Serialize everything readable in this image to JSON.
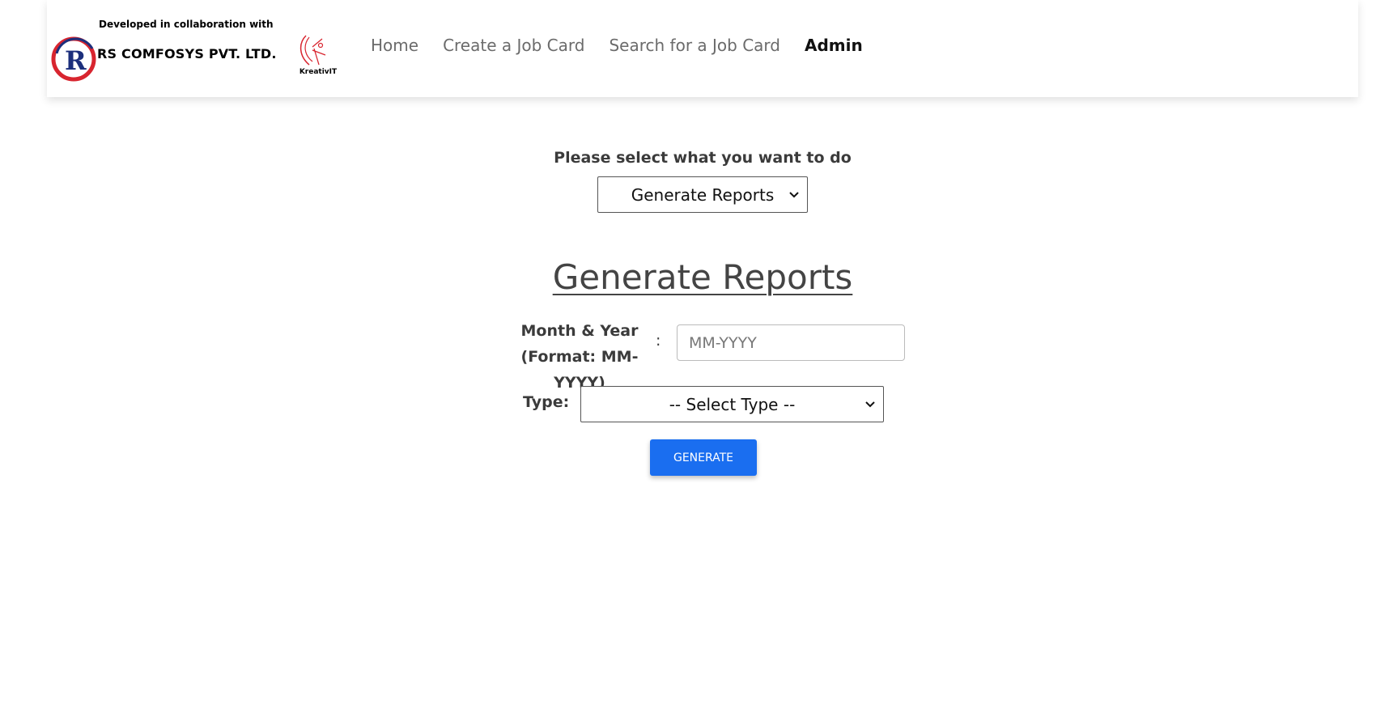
{
  "header": {
    "collab_caption": "Developed in collaboration with",
    "company_name": "RS COMFOSYS PVT. LTD.",
    "rs_logo_letter": "R",
    "partner_name": "KreativIT",
    "nav": [
      {
        "label": "Home"
      },
      {
        "label": "Create a Job Card"
      },
      {
        "label": "Search for a Job Card"
      },
      {
        "label": "Admin"
      }
    ]
  },
  "main": {
    "prompt": "Please select what you want to do",
    "action_select_value": "Generate Reports",
    "section_title": "Generate Reports",
    "month_label": "Month & Year (Format: MM-YYYY)",
    "month_colon": ":",
    "month_placeholder": "MM-YYYY",
    "type_label": "Type:",
    "type_select_value": "-- Select Type --",
    "generate_button": "GENERATE"
  },
  "colors": {
    "primary_button": "#1a6ef0",
    "logo_red": "#d8252f",
    "logo_blue": "#1c2f7c"
  },
  "icons": {
    "dropdown": "chevron-down-icon"
  }
}
